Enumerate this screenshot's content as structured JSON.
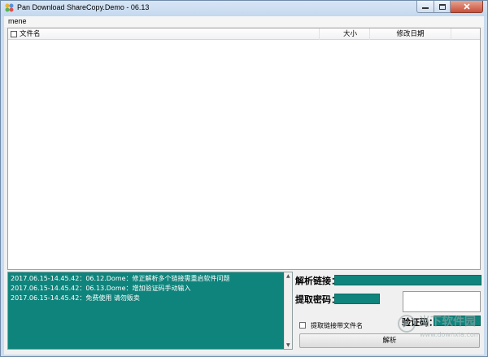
{
  "window": {
    "title": "Pan Download ShareCopy.Demo  -  06.13",
    "icons": {
      "app": "app-icon",
      "minimize": "minimize-icon",
      "maximize": "maximize-icon",
      "close": "close-icon"
    }
  },
  "menu": {
    "items": [
      {
        "label": "mene"
      }
    ]
  },
  "file_list": {
    "columns": [
      {
        "label": "文件名"
      },
      {
        "label": "大小"
      },
      {
        "label": "修改日期"
      }
    ],
    "rows": []
  },
  "log": {
    "lines": [
      "2017.06.15-14.45.42：06.12.Dome：修正解析多个链接需重启软件问题",
      "2017.06.15-14.45.42：06.13.Dome：增加验证码手动输入",
      "2017.06.15-14.45.42：免费使用 请勿贩卖"
    ]
  },
  "form": {
    "link_label": "解析链接：",
    "password_label": "提取密码：",
    "captcha_label": "验证码：",
    "checkbox_label": "提取链接带文件名",
    "parse_button": "解析"
  },
  "watermark": {
    "title": "当下软件园",
    "url": "www.downxia.com"
  },
  "colors": {
    "accent": "#0f847c",
    "titlebar": "#c9dcf0",
    "close": "#c8503a"
  }
}
